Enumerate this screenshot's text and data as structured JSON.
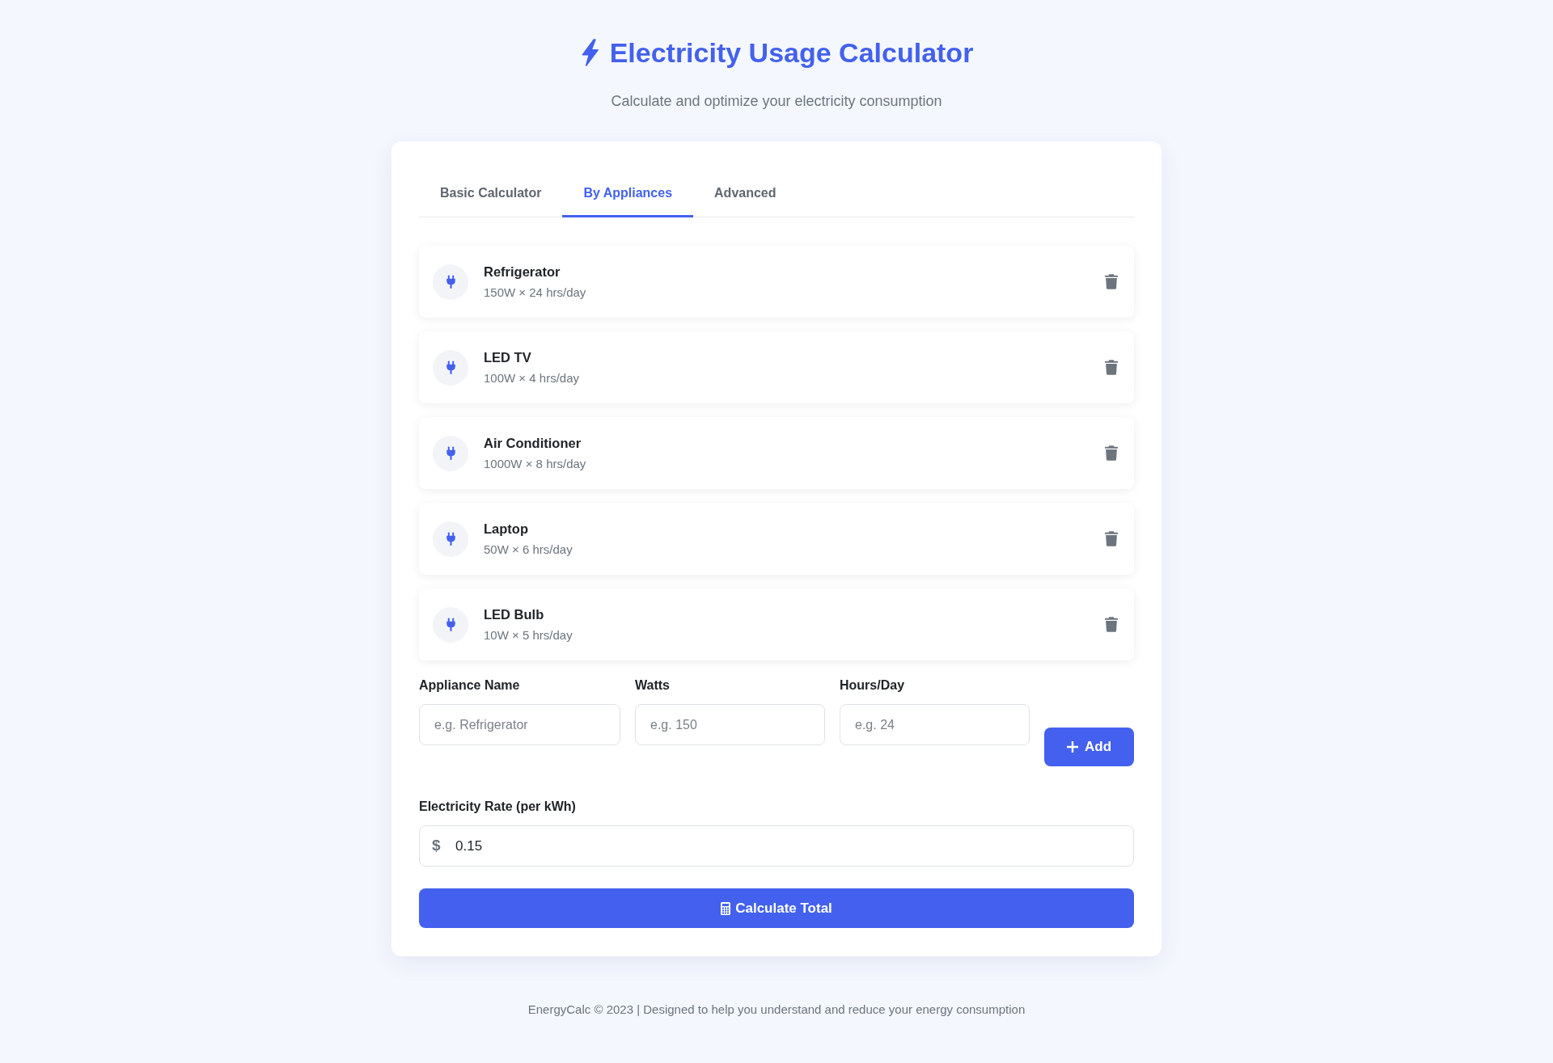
{
  "header": {
    "title": "Electricity Usage Calculator",
    "subtitle": "Calculate and optimize your electricity consumption"
  },
  "tabs": [
    {
      "label": "Basic Calculator",
      "selected": false
    },
    {
      "label": "By Appliances",
      "selected": true
    },
    {
      "label": "Advanced",
      "selected": false
    }
  ],
  "appliances": [
    {
      "name": "Refrigerator",
      "usage": "150W × 24 hrs/day"
    },
    {
      "name": "LED TV",
      "usage": "100W × 4 hrs/day"
    },
    {
      "name": "Air Conditioner",
      "usage": "1000W × 8 hrs/day"
    },
    {
      "name": "Laptop",
      "usage": "50W × 6 hrs/day"
    },
    {
      "name": "LED Bulb",
      "usage": "10W × 5 hrs/day"
    }
  ],
  "add_form": {
    "fields": [
      {
        "label": "Appliance Name",
        "placeholder": "e.g. Refrigerator"
      },
      {
        "label": "Watts",
        "placeholder": "e.g. 150"
      },
      {
        "label": "Hours/Day",
        "placeholder": "e.g. 24"
      }
    ],
    "add_button": "Add"
  },
  "rate": {
    "label": "Electricity Rate (per kWh)",
    "currency_symbol": "$",
    "value": "0.15"
  },
  "calculate_button": "Calculate Total",
  "footer": "EnergyCalc © 2023 | Designed to help you understand and reduce your energy consumption"
}
